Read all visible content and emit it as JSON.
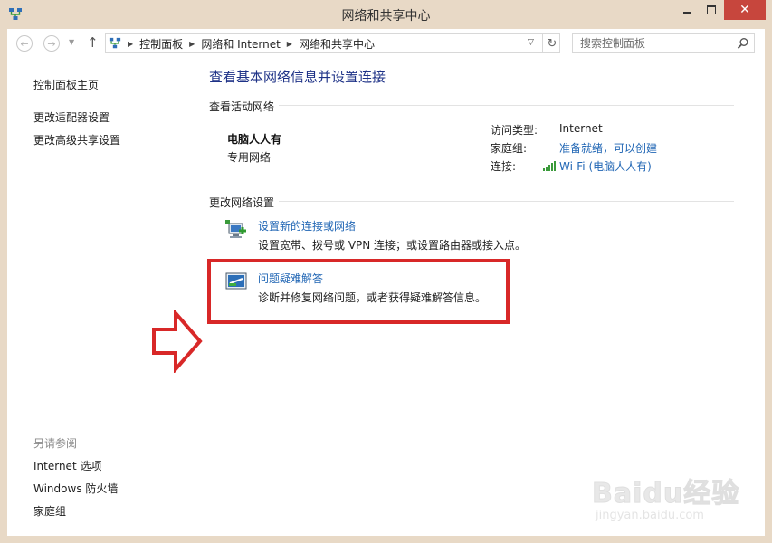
{
  "window": {
    "title": "网络和共享中心",
    "close_glyph": "✕"
  },
  "address_bar": {
    "crumbs": [
      "控制面板",
      "网络和 Internet",
      "网络和共享中心"
    ],
    "search_placeholder": "搜索控制面板"
  },
  "sidebar": {
    "home": "控制面板主页",
    "links": [
      "更改适配器设置",
      "更改高级共享设置"
    ],
    "see_also_header": "另请参阅",
    "see_also": [
      "Internet 选项",
      "Windows 防火墙",
      "家庭组"
    ]
  },
  "main": {
    "title": "查看基本网络信息并设置连接",
    "active_networks_header": "查看活动网络",
    "network": {
      "name": "电脑人人有",
      "type": "专用网络",
      "access_type_label": "访问类型:",
      "access_type_value": "Internet",
      "homegroup_label": "家庭组:",
      "homegroup_value": "准备就绪，可以创建",
      "connection_label": "连接:",
      "connection_value": "Wi-Fi (电脑人人有)"
    },
    "change_settings_header": "更改网络设置",
    "tasks": [
      {
        "title": "设置新的连接或网络",
        "desc": "设置宽带、拨号或 VPN 连接；或设置路由器或接入点。"
      },
      {
        "title": "问题疑难解答",
        "desc": "诊断并修复网络问题，或者获得疑难解答信息。"
      }
    ]
  },
  "watermark": {
    "logo": "Baidu经验",
    "sub": "jingyan.baidu.com"
  },
  "colors": {
    "accent_link": "#2267b5",
    "title_blue": "#1e3287",
    "highlight_red": "#d82828",
    "frame": "#e8d9c6"
  }
}
